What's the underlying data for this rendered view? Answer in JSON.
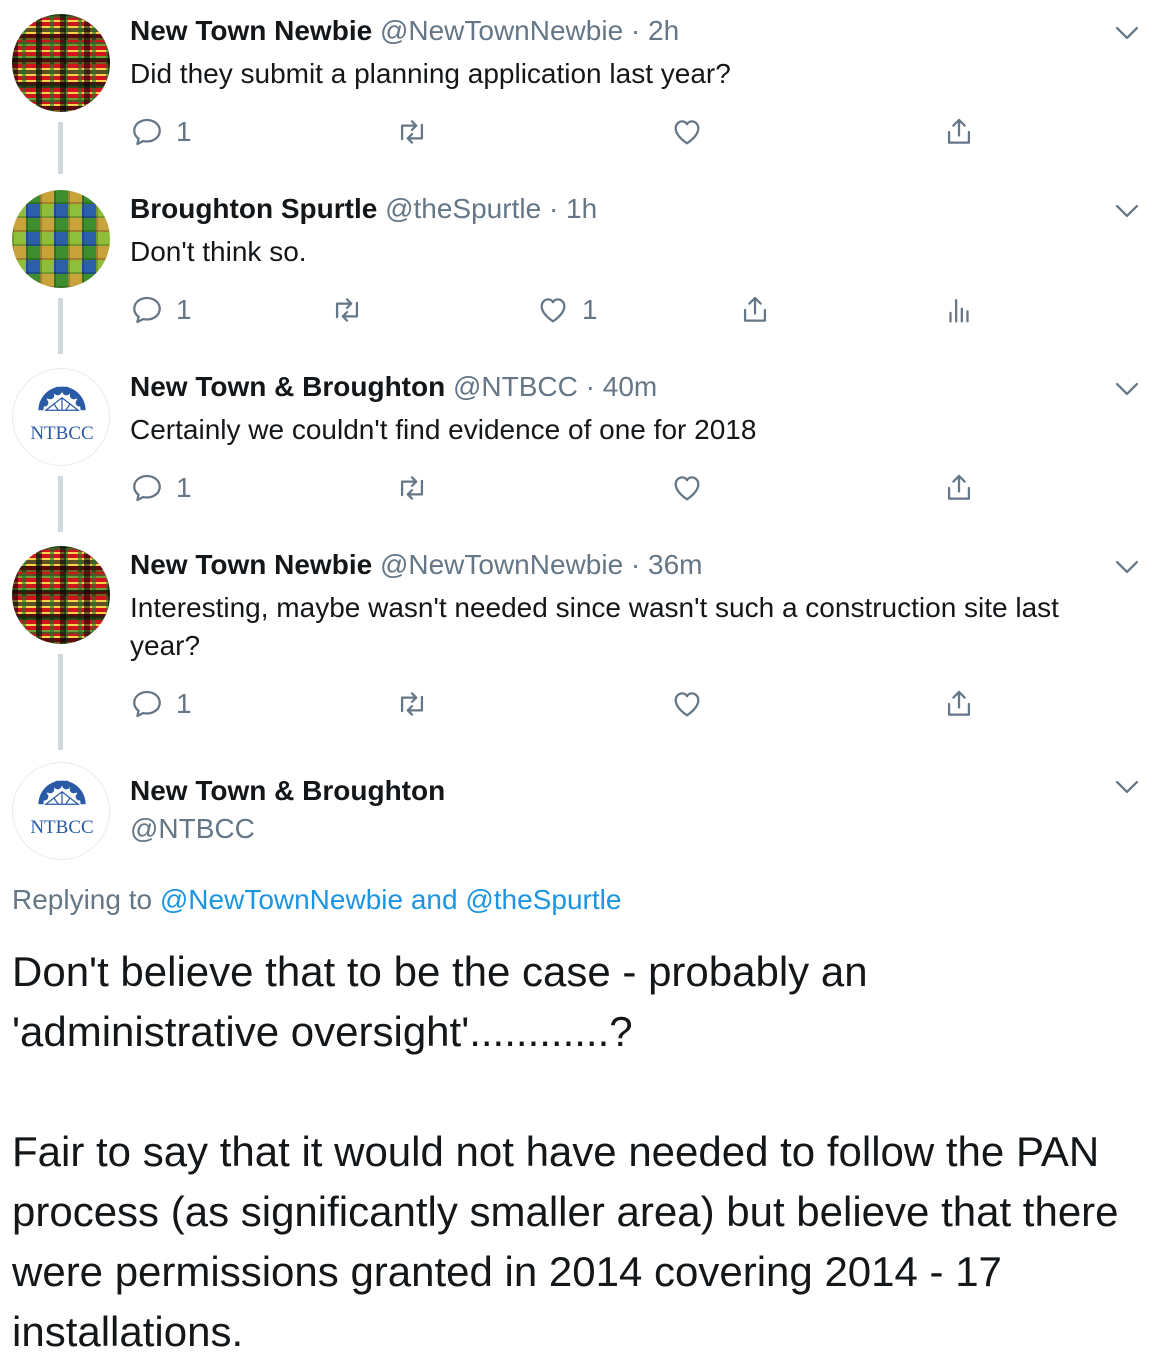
{
  "tweets": [
    {
      "name": "New Town Newbie",
      "handle": "@NewTownNewbie",
      "sep": "·",
      "time": "2h",
      "text": "Did they submit a planning application last year?",
      "replies": "1",
      "likes": ""
    },
    {
      "name": "Broughton Spurtle",
      "handle": "@theSpurtle",
      "sep": "·",
      "time": "1h",
      "text": "Don't think so.",
      "replies": "1",
      "likes": "1"
    },
    {
      "name": "New Town & Broughton",
      "handle": "@NTBCC",
      "sep": "·",
      "time": "40m",
      "text": "Certainly we couldn't find evidence of one for 2018",
      "replies": "1",
      "likes": ""
    },
    {
      "name": "New Town Newbie",
      "handle": "@NewTownNewbie",
      "sep": "·",
      "time": "36m",
      "text": "Interesting, maybe wasn't needed since wasn't such a construction site last year?",
      "replies": "1",
      "likes": ""
    }
  ],
  "main_tweet": {
    "name": "New Town & Broughton",
    "handle": "@NTBCC",
    "avatar_text": "NTBCC",
    "replying_prefix": "Replying to",
    "reply_user_1": "@NewTownNewbie",
    "reply_and": "and",
    "reply_user_2": "@theSpurtle",
    "text": "Don't believe that to be the case - probably an 'administrative oversight'............?\n\nFair to say that it would not have needed to follow the PAN process (as significantly smaller area) but believe that there were permissions granted in 2014 covering 2014 - 17 installations."
  },
  "avatar_label": "NTBCC",
  "icons": {
    "reply": "reply-icon",
    "retweet": "retweet-icon",
    "like": "heart-icon",
    "share": "share-icon",
    "analytics": "analytics-icon",
    "more": "chevron-down-icon"
  },
  "colors": {
    "link": "#1b95e0",
    "secondary": "#657786",
    "thread_line": "#cfd9de",
    "ntbcc_blue": "#2a5aa6"
  }
}
